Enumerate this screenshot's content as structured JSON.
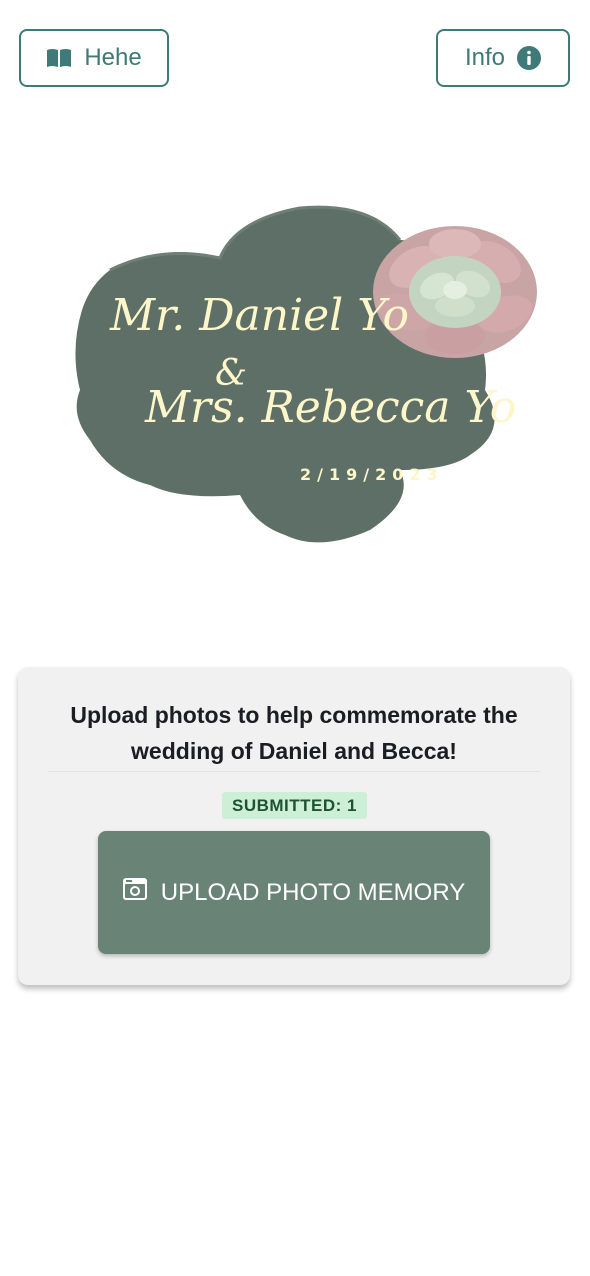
{
  "header": {
    "left_button_label": "Hehe",
    "left_button_icon": "book-open-icon",
    "right_button_label": "Info",
    "right_button_icon": "info-circle-icon",
    "accent_color": "#3d7a78"
  },
  "logo": {
    "line1": "Mr. Daniel Yo",
    "ampersand": "&",
    "line2": "Mrs. Rebecca Yo",
    "date": "2/19/2023",
    "background_color": "#5d6f66",
    "text_color": "#fdf6c9",
    "decoration_icon": "succulent-flower"
  },
  "card": {
    "title_line1": "Upload photos to help commemorate the",
    "title_line2": "wedding of Daniel and Becca!",
    "submitted_label": "SUBMITTED: 1",
    "upload_button_label": "UPLOAD PHOTO MEMORY",
    "upload_button_icon": "camera-icon",
    "upload_button_color": "#698377",
    "badge_color": "#cdefd6"
  }
}
